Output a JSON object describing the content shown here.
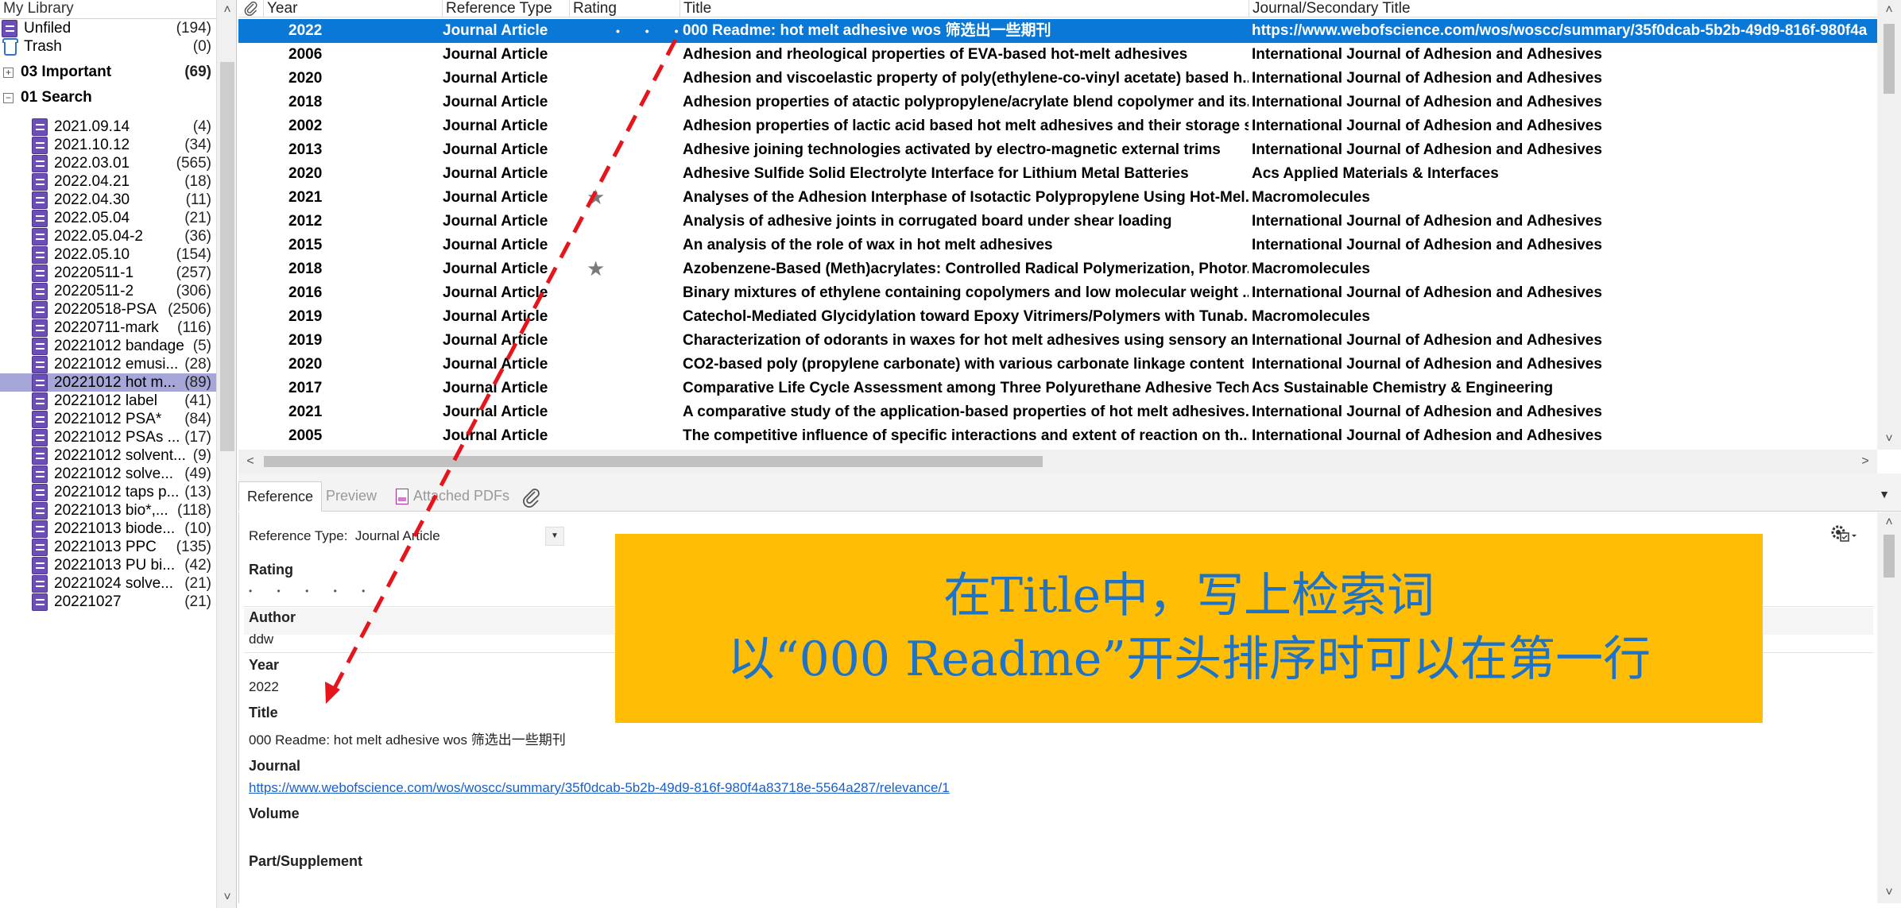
{
  "sidebar": {
    "top_label": "My Library",
    "items": [
      {
        "label": "Unfiled",
        "count": "(194)",
        "icon": "book-icon",
        "kind": "item0"
      },
      {
        "label": "Trash",
        "count": "(0)",
        "icon": "trash-icon",
        "kind": "item0"
      },
      {
        "label": "03 Important",
        "count": "(69)",
        "icon": "expand-icon",
        "kind": "group",
        "expander": "+"
      },
      {
        "label": "01 Search",
        "count": "",
        "icon": "collapse-icon",
        "kind": "group",
        "expander": "−"
      },
      {
        "label": "2021.09.14",
        "count": "(4)",
        "icon": "book-icon",
        "kind": "item1"
      },
      {
        "label": "2021.10.12",
        "count": "(34)",
        "icon": "book-icon",
        "kind": "item1"
      },
      {
        "label": "2022.03.01",
        "count": "(565)",
        "icon": "book-icon",
        "kind": "item1"
      },
      {
        "label": "2022.04.21",
        "count": "(18)",
        "icon": "book-icon",
        "kind": "item1"
      },
      {
        "label": "2022.04.30",
        "count": "(11)",
        "icon": "book-icon",
        "kind": "item1"
      },
      {
        "label": "2022.05.04",
        "count": "(21)",
        "icon": "book-icon",
        "kind": "item1"
      },
      {
        "label": "2022.05.04-2",
        "count": "(36)",
        "icon": "book-icon",
        "kind": "item1"
      },
      {
        "label": "2022.05.10",
        "count": "(154)",
        "icon": "book-icon",
        "kind": "item1"
      },
      {
        "label": "20220511-1",
        "count": "(257)",
        "icon": "book-icon",
        "kind": "item1"
      },
      {
        "label": "20220511-2",
        "count": "(306)",
        "icon": "book-icon",
        "kind": "item1"
      },
      {
        "label": "20220518-PSA",
        "count": "(2506)",
        "icon": "book-icon",
        "kind": "item1"
      },
      {
        "label": "20220711-mark",
        "count": "(116)",
        "icon": "book-icon",
        "kind": "item1"
      },
      {
        "label": "20221012 bandage",
        "count": "(5)",
        "icon": "book-icon",
        "kind": "item1"
      },
      {
        "label": "20221012 emusi...",
        "count": "(28)",
        "icon": "book-icon",
        "kind": "item1"
      },
      {
        "label": "20221012 hot m...",
        "count": "(89)",
        "icon": "book-icon",
        "kind": "item1",
        "selected": true
      },
      {
        "label": "20221012 label",
        "count": "(41)",
        "icon": "book-icon",
        "kind": "item1"
      },
      {
        "label": "20221012 PSA*",
        "count": "(84)",
        "icon": "book-icon",
        "kind": "item1"
      },
      {
        "label": "20221012 PSAs ...",
        "count": "(17)",
        "icon": "book-icon",
        "kind": "item1"
      },
      {
        "label": "20221012 solvent...",
        "count": "(9)",
        "icon": "book-icon",
        "kind": "item1"
      },
      {
        "label": "20221012 solve...",
        "count": "(49)",
        "icon": "book-icon",
        "kind": "item1"
      },
      {
        "label": "20221012 taps p...",
        "count": "(13)",
        "icon": "book-icon",
        "kind": "item1"
      },
      {
        "label": "20221013 bio*,...",
        "count": "(118)",
        "icon": "book-icon",
        "kind": "item1"
      },
      {
        "label": "20221013 biode...",
        "count": "(10)",
        "icon": "book-icon",
        "kind": "item1"
      },
      {
        "label": "20221013 PPC",
        "count": "(135)",
        "icon": "book-icon",
        "kind": "item1"
      },
      {
        "label": "20221013 PU bi...",
        "count": "(42)",
        "icon": "book-icon",
        "kind": "item1"
      },
      {
        "label": "20221024 solve...",
        "count": "(21)",
        "icon": "book-icon",
        "kind": "item1"
      },
      {
        "label": "20221027",
        "count": "(21)",
        "icon": "book-icon",
        "kind": "item1"
      }
    ]
  },
  "reflist": {
    "columns": [
      "Year",
      "Reference Type",
      "Rating",
      "Title",
      "Journal/Secondary Title"
    ],
    "attach_icon": "paperclip-icon",
    "rows": [
      {
        "year": "2022",
        "type": "Journal Article",
        "rating": "dots",
        "title": "000 Readme: hot melt adhesive wos 筛选出一些期刊",
        "journal": "https://www.webofscience.com/wos/woscc/summary/35f0dcab-5b2b-49d9-816f-980f4a",
        "selected": true
      },
      {
        "year": "2006",
        "type": "Journal Article",
        "rating": "",
        "title": "Adhesion and rheological properties of EVA-based hot-melt adhesives",
        "journal": "International Journal of Adhesion and Adhesives"
      },
      {
        "year": "2020",
        "type": "Journal Article",
        "rating": "",
        "title": "Adhesion and viscoelastic property of poly(ethylene-co-vinyl acetate) based h...",
        "journal": "International Journal of Adhesion and Adhesives"
      },
      {
        "year": "2018",
        "type": "Journal Article",
        "rating": "",
        "title": "Adhesion properties of atactic polypropylene/acrylate blend copolymer and its...",
        "journal": "International Journal of Adhesion and Adhesives"
      },
      {
        "year": "2002",
        "type": "Journal Article",
        "rating": "",
        "title": "Adhesion properties of lactic acid based hot melt adhesives and their storage s...",
        "journal": "International Journal of Adhesion and Adhesives"
      },
      {
        "year": "2013",
        "type": "Journal Article",
        "rating": "",
        "title": "Adhesive joining technologies activated by electro-magnetic external trims",
        "journal": "International Journal of Adhesion and Adhesives"
      },
      {
        "year": "2020",
        "type": "Journal Article",
        "rating": "",
        "title": "Adhesive Sulfide Solid Electrolyte Interface for Lithium Metal Batteries",
        "journal": "Acs Applied Materials & Interfaces"
      },
      {
        "year": "2021",
        "type": "Journal Article",
        "rating": "star",
        "title": "Analyses of the Adhesion Interphase of Isotactic Polypropylene Using Hot-Mel...",
        "journal": "Macromolecules"
      },
      {
        "year": "2012",
        "type": "Journal Article",
        "rating": "",
        "title": "Analysis of adhesive joints in corrugated board under shear loading",
        "journal": "International Journal of Adhesion and Adhesives"
      },
      {
        "year": "2015",
        "type": "Journal Article",
        "rating": "",
        "title": "An analysis of the role of wax in hot melt adhesives",
        "journal": "International Journal of Adhesion and Adhesives"
      },
      {
        "year": "2018",
        "type": "Journal Article",
        "rating": "star",
        "title": "Azobenzene-Based (Meth)acrylates: Controlled Radical Polymerization, Photor...",
        "journal": "Macromolecules"
      },
      {
        "year": "2016",
        "type": "Journal Article",
        "rating": "",
        "title": "Binary mixtures of ethylene containing copolymers and low molecular weight ...",
        "journal": "International Journal of Adhesion and Adhesives"
      },
      {
        "year": "2019",
        "type": "Journal Article",
        "rating": "",
        "title": "Catechol-Mediated Glycidylation toward Epoxy Vitrimers/Polymers with Tunab...",
        "journal": "Macromolecules"
      },
      {
        "year": "2019",
        "type": "Journal Article",
        "rating": "",
        "title": "Characterization of odorants in waxes for hot melt adhesives using sensory an...",
        "journal": "International Journal of Adhesion and Adhesives"
      },
      {
        "year": "2020",
        "type": "Journal Article",
        "rating": "",
        "title": "CO2-based poly (propylene carbonate) with various carbonate linkage content ...",
        "journal": "International Journal of Adhesion and Adhesives"
      },
      {
        "year": "2017",
        "type": "Journal Article",
        "rating": "",
        "title": "Comparative Life Cycle Assessment among Three Polyurethane Adhesive Tech...",
        "journal": "Acs Sustainable Chemistry & Engineering"
      },
      {
        "year": "2021",
        "type": "Journal Article",
        "rating": "",
        "title": "A comparative study of the application-based properties of hot melt adhesives...",
        "journal": "International Journal of Adhesion and Adhesives"
      },
      {
        "year": "2005",
        "type": "Journal Article",
        "rating": "",
        "title": "The competitive influence of specific interactions and extent of reaction on th...",
        "journal": "International Journal of Adhesion and Adhesives"
      }
    ]
  },
  "tabs": {
    "reference": "Reference",
    "preview": "Preview",
    "attached_pdfs": "Attached PDFs"
  },
  "panel": {
    "reference_type_label": "Reference Type:",
    "reference_type_value": "Journal Article",
    "fields": {
      "rating_label": "Rating",
      "author_label": "Author",
      "author_value": "ddw",
      "year_label": "Year",
      "year_value": "2022",
      "title_label": "Title",
      "title_value": "000 Readme: hot melt adhesive wos 筛选出一些期刊",
      "journal_label": "Journal",
      "journal_value": "https://www.webofscience.com/wos/woscc/summary/35f0dcab-5b2b-49d9-816f-980f4a83718e-5564a287/relevance/1",
      "volume_label": "Volume",
      "part_label": "Part/Supplement"
    }
  },
  "callout": {
    "line1": "在Title中，写上检索词",
    "line2": "以“000 Readme”开头排序时可以在第一行"
  },
  "colors": {
    "selection": "#0a78d7",
    "sidebar_selection": "#a6a6d8",
    "callout_bg": "#ffbd06",
    "callout_text": "#1f73c6",
    "arrow": "#e8141b"
  }
}
